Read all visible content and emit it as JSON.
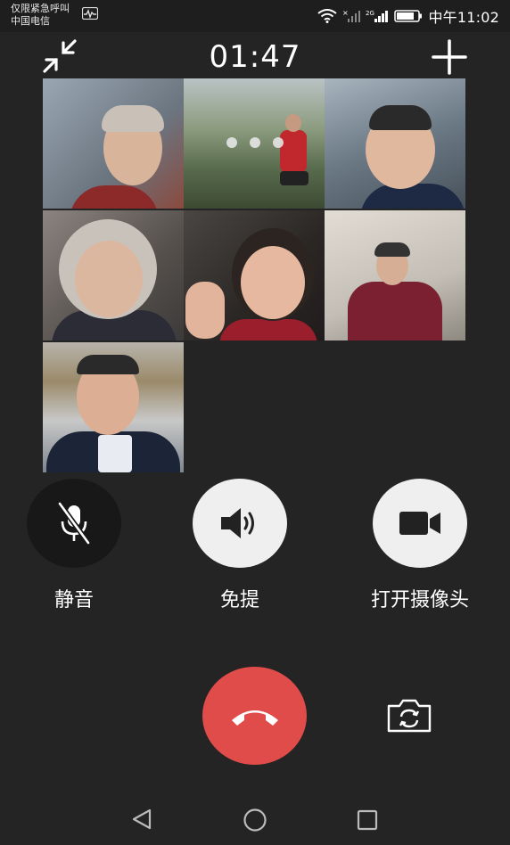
{
  "status_bar": {
    "carrier_line1": "仅限紧急呼叫",
    "carrier_line2": "中国电信",
    "network_label": "2G",
    "clock": "中午11:02"
  },
  "header": {
    "timer": "01:47",
    "collapse_icon": "collapse-arrows-icon",
    "add_icon": "plus-icon"
  },
  "participants": [
    {
      "name": "participant-1",
      "bg": "#7e8a96"
    },
    {
      "name": "participant-2",
      "bg": "#5e6b55"
    },
    {
      "name": "participant-3",
      "bg": "#8a97a4"
    },
    {
      "name": "participant-4",
      "bg": "#6d6864"
    },
    {
      "name": "participant-5",
      "bg": "#3a3634"
    },
    {
      "name": "participant-6",
      "bg": "#c9c4bc"
    },
    {
      "name": "participant-7",
      "bg": "#9aa0a6"
    }
  ],
  "controls": {
    "mute_label": "静音",
    "speaker_label": "免提",
    "camera_label": "打开摄像头"
  },
  "colors": {
    "background": "#242424",
    "hangup": "#e04c4a",
    "control_light": "#efefef",
    "control_dark": "#181818"
  }
}
